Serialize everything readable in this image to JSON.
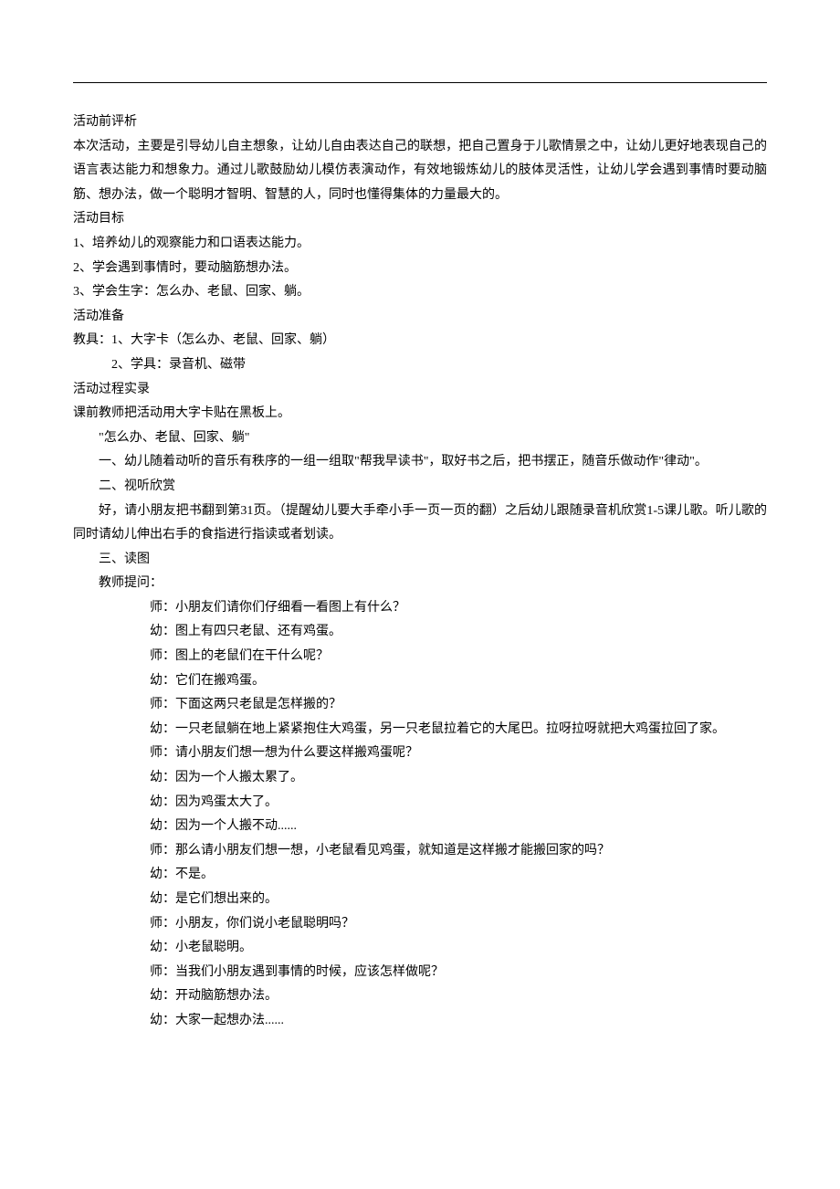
{
  "sections": {
    "analysis": {
      "title": "活动前评析",
      "body": "本次活动，主要是引导幼儿自主想象，让幼儿自由表达自己的联想，把自己置身于儿歌情景之中，让幼儿更好地表现自己的语言表达能力和想象力。通过儿歌鼓励幼儿模仿表演动作，有效地锻炼幼儿的肢体灵活性，让幼儿学会遇到事情时要动脑筋、想办法，做一个聪明才智明、智慧的人，同时也懂得集体的力量最大的。"
    },
    "goals": {
      "title": "活动目标",
      "items": [
        "1、培养幼儿的观察能力和口语表达能力。",
        "2、学会遇到事情时，要动脑筋想办法。",
        "3、学会生字：怎么办、老鼠、回家、躺。"
      ]
    },
    "prep": {
      "title": "活动准备",
      "line1": "教具：1、大字卡（怎么办、老鼠、回家、躺）",
      "line2": "2、学具：录音机、磁带"
    },
    "process": {
      "title": "活动过程实录",
      "pre": "课前教师把活动用大字卡贴在黑板上。",
      "cards": "\"怎么办、老鼠、回家、躺\"",
      "step1": "一、幼儿随着动听的音乐有秩序的一组一组取\"帮我早读书\"，取好书之后，把书摆正，随音乐做动作\"律动\"。",
      "step2_title": "二、视听欣赏",
      "step2_body": "好，请小朋友把书翻到第31页。（提醒幼儿要大手牵小手一页一页的翻）之后幼儿跟随录音机欣赏1-5课儿歌。听儿歌的同时请幼儿伸出右手的食指进行指读或者划读。",
      "step3_title": "三、读图",
      "step3_sub": "教师提问：",
      "dialogue": [
        "师：小朋友们请你们仔细看一看图上有什么？",
        "幼：图上有四只老鼠、还有鸡蛋。",
        "师：图上的老鼠们在干什么呢？",
        "幼：它们在搬鸡蛋。",
        "师：下面这两只老鼠是怎样搬的？",
        "幼：一只老鼠躺在地上紧紧抱住大鸡蛋，另一只老鼠拉着它的大尾巴。拉呀拉呀就把大鸡蛋拉回了家。",
        "师：请小朋友们想一想为什么要这样搬鸡蛋呢？",
        "幼：因为一个人搬太累了。",
        "幼：因为鸡蛋太大了。",
        "幼：因为一个人搬不动......",
        "师：那么请小朋友们想一想，小老鼠看见鸡蛋，就知道是这样搬才能搬回家的吗？",
        "幼：不是。",
        "幼：是它们想出来的。",
        "师：小朋友，你们说小老鼠聪明吗？",
        "幼：小老鼠聪明。",
        "师：当我们小朋友遇到事情的时候，应该怎样做呢？",
        "幼：开动脑筋想办法。",
        "幼：大家一起想办法......"
      ]
    }
  }
}
